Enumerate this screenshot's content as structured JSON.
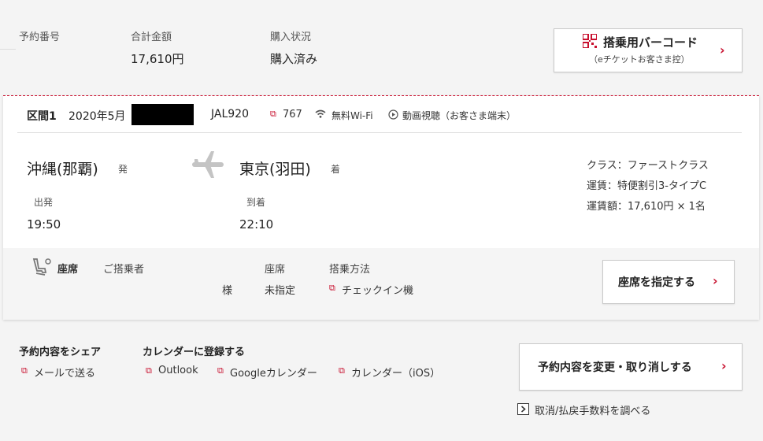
{
  "summary": {
    "reservation_no_label": "予約番号",
    "total_label": "合計金額",
    "total_value": "17,610円",
    "purchase_status_label": "購入状況",
    "purchase_status_value": "購入済み",
    "barcode_button_label": "搭乗用バーコード",
    "barcode_button_sub": "（eチケットお客さま控）"
  },
  "segment": {
    "label": "区間1",
    "date": "2020年5月",
    "flight": "JAL920",
    "aircraft": "767",
    "wifi": "無料Wi-Fi",
    "video": "動画視聴（お客さま端末）",
    "origin": "沖縄(那覇)",
    "origin_suffix": "発",
    "destination": "東京(羽田)",
    "destination_suffix": "着",
    "departure_label": "出発",
    "departure_time": "19:50",
    "arrival_label": "到着",
    "arrival_time": "22:10",
    "class_text": "クラス：ファーストクラス",
    "fare_text": "運賃：特便割引3-タイプC",
    "fare_amount_text": "運賃額：17,610円 × 1名"
  },
  "seat": {
    "section_label": "座席",
    "passenger_label": "ご搭乗者",
    "seat_col_label": "座席",
    "boarding_label": "搭乗方法",
    "honorific": "様",
    "seat_value": "未指定",
    "boarding_value": "チェックイン機",
    "select_button": "座席を指定する"
  },
  "share": {
    "label": "予約内容をシェア",
    "email": "メールで送る"
  },
  "calendar": {
    "label": "カレンダーに登録する",
    "outlook": "Outlook",
    "google": "Googleカレンダー",
    "ios": "カレンダー（iOS）"
  },
  "actions": {
    "change_cancel": "予約内容を変更・取り消しする",
    "fee_link": "取消/払戻手数料を調べる"
  },
  "colors": {
    "accent": "#c8102e"
  }
}
